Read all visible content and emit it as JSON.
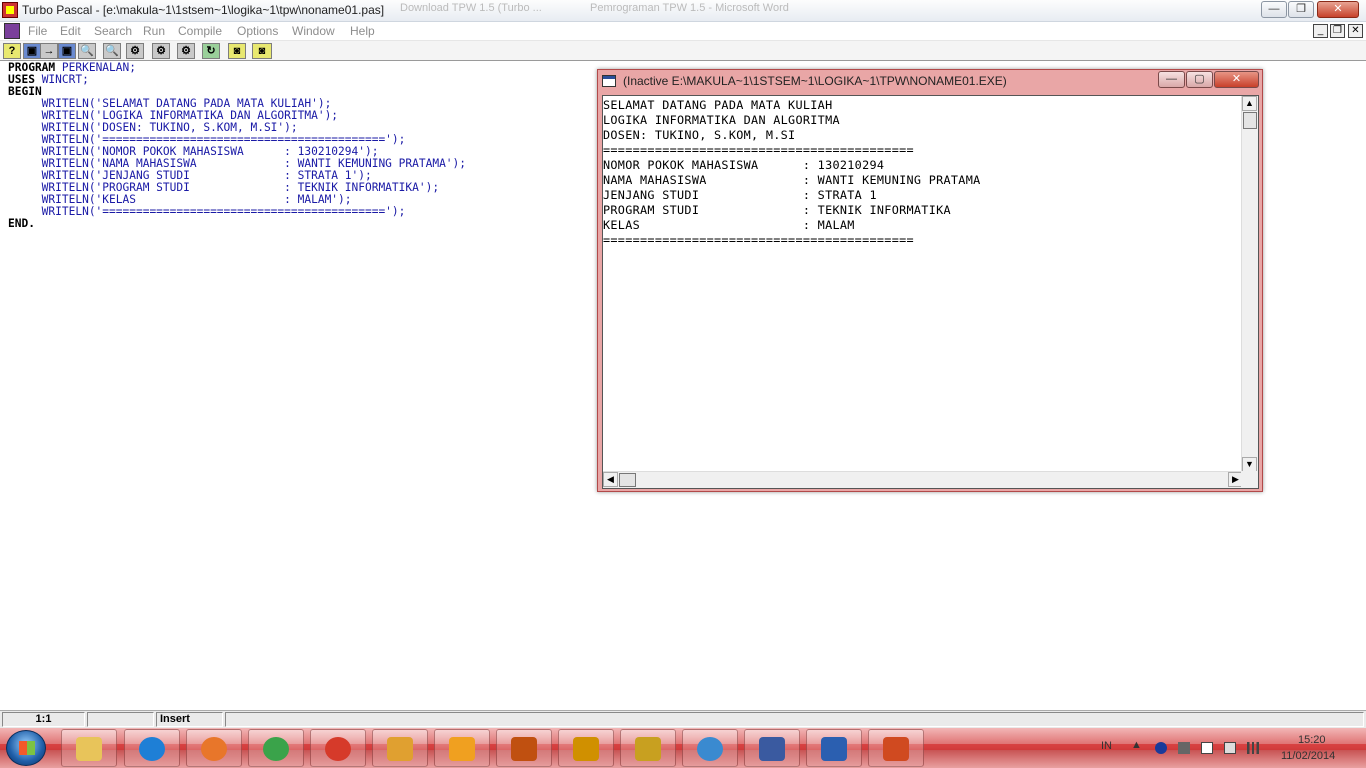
{
  "main_window": {
    "title": "Turbo Pascal - [e:\\makula~1\\1stsem~1\\logika~1\\tpw\\noname01.pas]",
    "ghost_tab_1": "Download TPW 1.5 (Turbo ...",
    "ghost_tab_2": "Pemrograman TPW 1.5 - Microsoft Word",
    "min_glyph": "—",
    "max_glyph": "❐",
    "close_glyph": "✕"
  },
  "menu": {
    "items": [
      "File",
      "Edit",
      "Search",
      "Run",
      "Compile",
      "Options",
      "Window",
      "Help"
    ],
    "mdi_min": "_",
    "mdi_restore": "❐",
    "mdi_close": "✕"
  },
  "toolbar": {
    "icons": [
      "help-icon",
      "save-icon",
      "open-icon",
      "save-as-icon",
      "find-icon",
      "find-next-icon",
      "compile-icon",
      "make-icon",
      "build-icon",
      "run-icon",
      "step-icon",
      "trace-icon"
    ],
    "glyphs": [
      "?",
      "▣",
      "→",
      "▣",
      "🔍",
      "🔍",
      "⚙",
      "⚙",
      "⚙",
      "↻",
      "◙",
      "◙"
    ]
  },
  "editor": {
    "lines": [
      {
        "kw": "PROGRAM",
        "rest": " PERKENALAN;"
      },
      {
        "kw": "USES",
        "rest": " WINCRT;"
      },
      {
        "kw": "BEGIN",
        "rest": ""
      },
      {
        "kw": "",
        "rest": "     WRITELN('SELAMAT DATANG PADA MATA KULIAH');"
      },
      {
        "kw": "",
        "rest": "     WRITELN('LOGIKA INFORMATIKA DAN ALGORITMA');"
      },
      {
        "kw": "",
        "rest": "     WRITELN('DOSEN: TUKINO, S.KOM, M.SI');"
      },
      {
        "kw": "",
        "rest": "     WRITELN('==========================================');"
      },
      {
        "kw": "",
        "rest": "     WRITELN('NOMOR POKOK MAHASISWA      : 130210294');"
      },
      {
        "kw": "",
        "rest": "     WRITELN('NAMA MAHASISWA             : WANTI KEMUNING PRATAMA');"
      },
      {
        "kw": "",
        "rest": "     WRITELN('JENJANG STUDI              : STRATA 1');"
      },
      {
        "kw": "",
        "rest": "     WRITELN('PROGRAM STUDI              : TEKNIK INFORMATIKA');"
      },
      {
        "kw": "",
        "rest": "     WRITELN('KELAS                      : MALAM');"
      },
      {
        "kw": "",
        "rest": "     WRITELN('==========================================');"
      },
      {
        "kw": "END.",
        "rest": ""
      }
    ]
  },
  "output_window": {
    "title": "(Inactive E:\\MAKULA~1\\1STSEM~1\\LOGIKA~1\\TPW\\NONAME01.EXE)",
    "min_glyph": "—",
    "max_glyph": "▢",
    "close_glyph": "✕",
    "up_arrow": "▲",
    "down_arrow": "▼",
    "left_arrow": "◀",
    "right_arrow": "▶",
    "lines": [
      "SELAMAT DATANG PADA MATA KULIAH",
      "LOGIKA INFORMATIKA DAN ALGORITMA",
      "DOSEN: TUKINO, S.KOM, M.SI",
      "==========================================",
      "NOMOR POKOK MAHASISWA      : 130210294",
      "NAMA MAHASISWA             : WANTI KEMUNING PRATAMA",
      "JENJANG STUDI              : STRATA 1",
      "PROGRAM STUDI              : TEKNIK INFORMATIKA",
      "KELAS                      : MALAM",
      "=========================================="
    ]
  },
  "status": {
    "position": "1:1",
    "modified": "",
    "mode": "Insert"
  },
  "taskbar": {
    "apps": [
      "explorer-icon",
      "ie-icon",
      "firefox-icon",
      "chrome-icon",
      "burner-icon",
      "paint-icon",
      "media-player-icon",
      "presentation-icon",
      "winamp-icon",
      "music-icon",
      "network-icon",
      "turbo-pascal-icon",
      "word-icon",
      "powerpoint-icon"
    ],
    "app_colors": [
      "#e8c45a",
      "#1e7fd6",
      "#e8762a",
      "#3aa34a",
      "#d63a2a",
      "#e0a030",
      "#f0a020",
      "#c05010",
      "#d09000",
      "#c8a020",
      "#3a8ad0",
      "#3a5aa0",
      "#2b5fb0",
      "#d04a20"
    ],
    "language": "IN",
    "time": "15:20",
    "date": "11/02/2014"
  }
}
